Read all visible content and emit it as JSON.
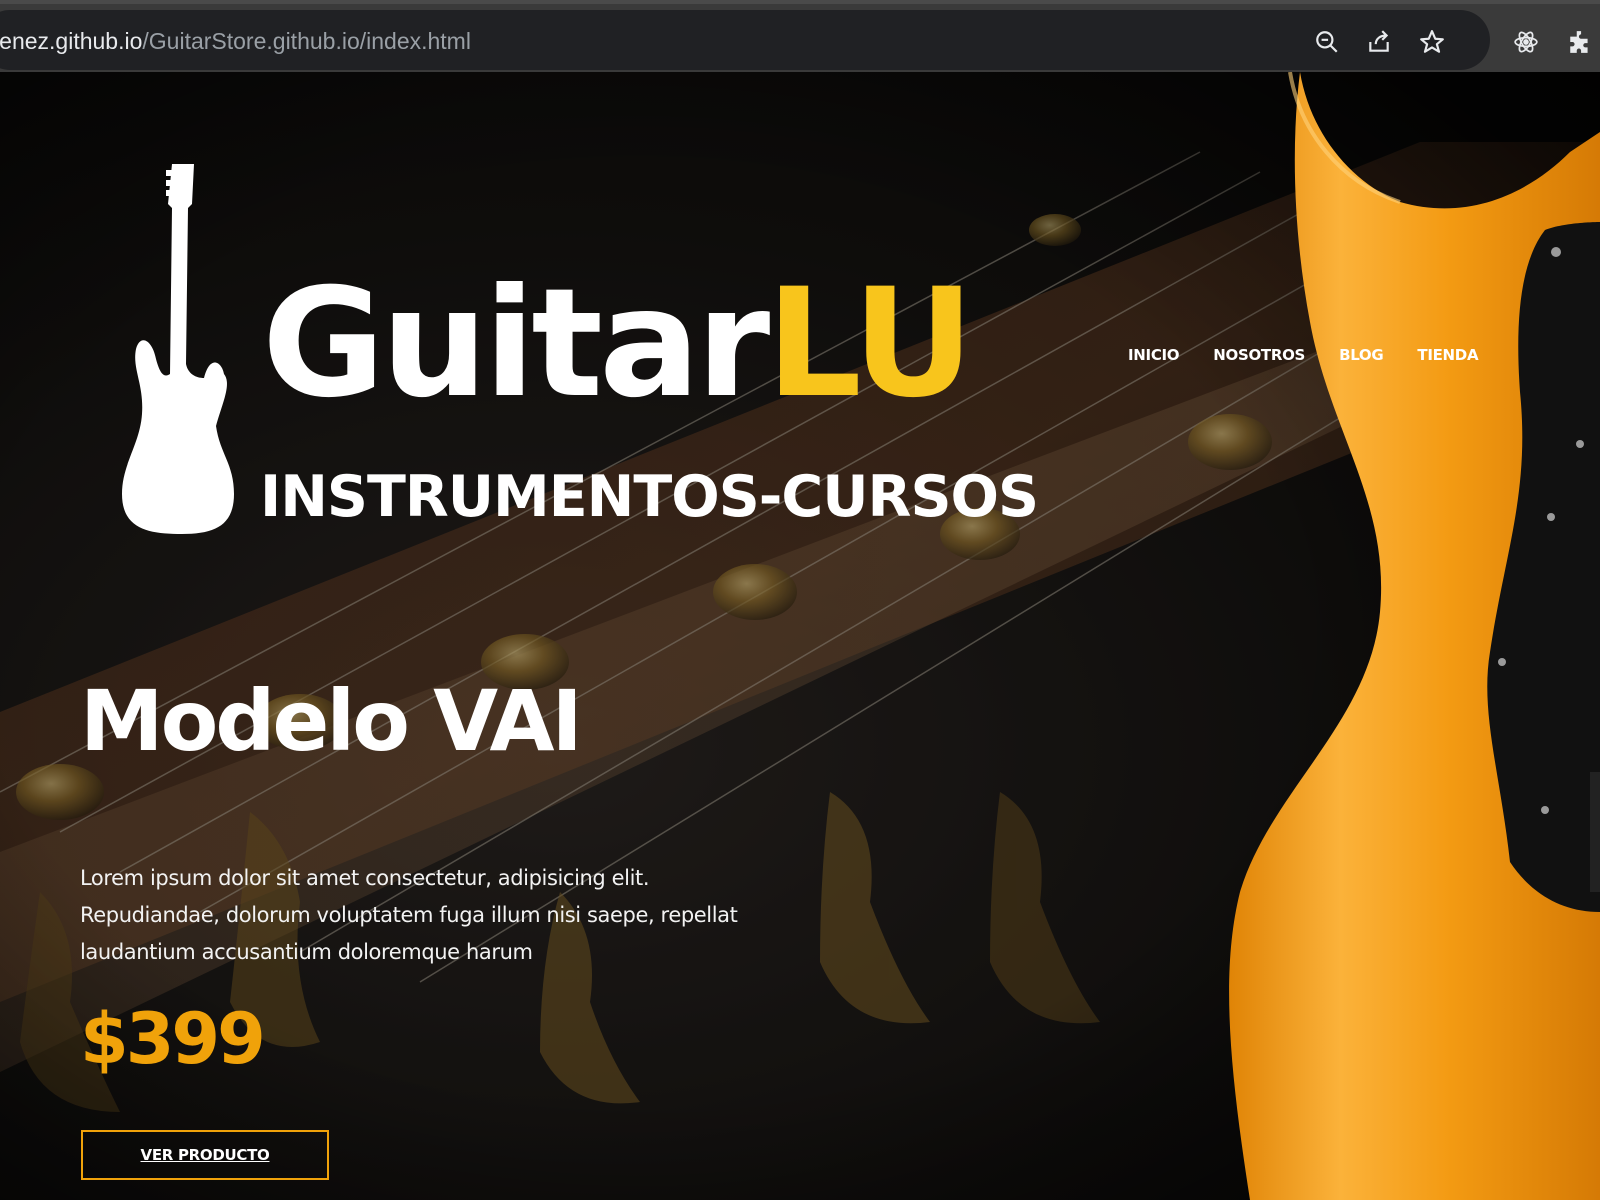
{
  "browser": {
    "url_host": "menez.github.io",
    "url_path": "/GuitarStore.github.io/index.html",
    "icons": [
      "zoom-icon",
      "share-icon",
      "bookmark-star-icon",
      "react-devtools-icon",
      "extensions-puzzle-icon"
    ]
  },
  "logo": {
    "word_primary": "Guitar",
    "word_accent": "LU",
    "tagline": "INSTRUMENTOS-CURSOS"
  },
  "nav": {
    "items": [
      "INICIO",
      "NOSOTROS",
      "BLOG",
      "TIENDA"
    ]
  },
  "hero": {
    "title": "Modelo VAI",
    "description": "Lorem ipsum dolor sit amet consectetur, adipisicing elit. Repudiandae, dolorum voluptatem fuga illum nisi saepe, repellat laudantium accusantium doloremque harum",
    "price": "$399",
    "cta_label": "VER PRODUCTO"
  },
  "colors": {
    "accent_yellow": "#f8c51c",
    "price_orange": "#f0a20a",
    "guitar_body_orange": "#f39a12",
    "background_dark": "#141414"
  }
}
